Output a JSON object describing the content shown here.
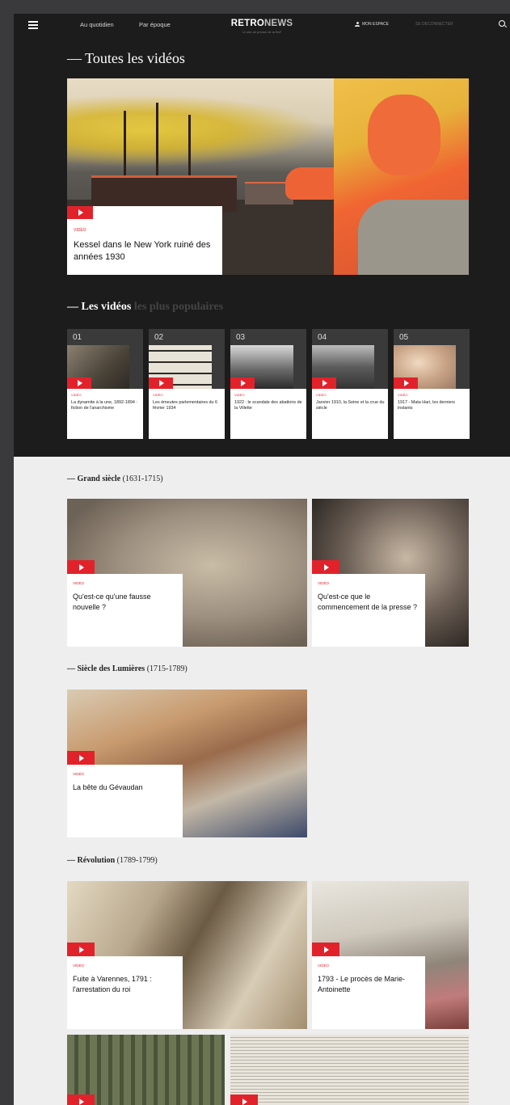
{
  "nav": {
    "links": [
      "Au quotidien",
      "Par époque"
    ],
    "logo_bold": "RETRO",
    "logo_light": "NEWS",
    "tagline": "Le site de presse de la BnF",
    "account": "MON ESPACE",
    "logout": "SE DÉCONNECTER"
  },
  "section_all": {
    "title": "— Toutes les vidéos",
    "hero": {
      "kind": "VIDÉO",
      "title": "Kessel dans le New York ruiné des années 1930"
    }
  },
  "section_popular": {
    "title": "— Les vidéos",
    "title_muted": " les plus populaires",
    "items": [
      {
        "num": "01",
        "kind": "VIDÉO",
        "title": "La dynamite à la une, 1892-1894 : fiction de l'anarchisme"
      },
      {
        "num": "02",
        "kind": "VIDÉO",
        "title": "Les émeutes parlementaires du 6 février 1934"
      },
      {
        "num": "03",
        "kind": "VIDÉO",
        "title": "1922 : le scandale des abattoirs de la Villette"
      },
      {
        "num": "04",
        "kind": "VIDÉO",
        "title": "Janvier 1910, la Seine et la crue du siècle"
      },
      {
        "num": "05",
        "kind": "VIDÉO",
        "title": "1917 - Mata Hari, les derniers instants"
      }
    ]
  },
  "sections": [
    {
      "label": "— Grand siècle",
      "years": " (1631-1715)",
      "videos": [
        {
          "kind": "VIDÉO",
          "title": "Qu'est-ce qu'une fausse nouvelle ?"
        },
        {
          "kind": "VIDÉO",
          "title": "Qu'est-ce que le commencement de la presse ?"
        }
      ]
    },
    {
      "label": "— Siècle des Lumières",
      "years": " (1715-1789)",
      "videos": [
        {
          "kind": "VIDÉO",
          "title": "La bête du Gévaudan"
        }
      ]
    },
    {
      "label": "— Révolution",
      "years": " (1789-1799)",
      "videos": [
        {
          "kind": "VIDÉO",
          "title": "Fuite à Varennes, 1791 : l'arrestation du roi"
        },
        {
          "kind": "VIDÉO",
          "title": "1793 - Le procès de Marie-Antoinette"
        }
      ]
    }
  ],
  "colors": {
    "accent": "#e2222b",
    "dark_bg": "#1c1c1c",
    "light_bg": "#eeeeee"
  },
  "icons": [
    "menu-icon",
    "user-icon",
    "search-icon",
    "play-icon"
  ]
}
